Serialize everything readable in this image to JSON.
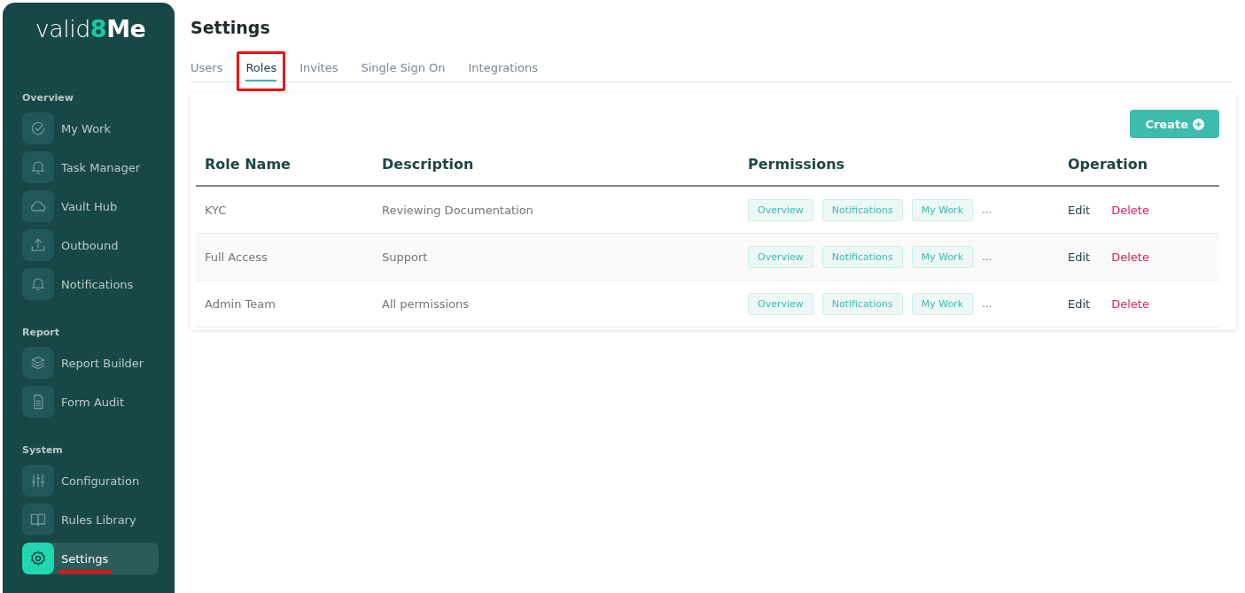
{
  "logo": {
    "parts": [
      "valid",
      "8",
      "Me"
    ]
  },
  "sidebar": {
    "sections": [
      {
        "title": "Overview",
        "items": [
          {
            "label": "My Work",
            "selected": false,
            "highlighted": false
          },
          {
            "label": "Task Manager",
            "selected": false,
            "highlighted": false
          },
          {
            "label": "Vault Hub",
            "selected": false,
            "highlighted": false
          },
          {
            "label": "Outbound",
            "selected": false,
            "highlighted": false
          },
          {
            "label": "Notifications",
            "selected": false,
            "highlighted": false
          }
        ]
      },
      {
        "title": "Report",
        "items": [
          {
            "label": "Report Builder",
            "selected": false,
            "highlighted": false
          },
          {
            "label": "Form Audit",
            "selected": false,
            "highlighted": false
          }
        ]
      },
      {
        "title": "System",
        "items": [
          {
            "label": "Configuration",
            "selected": false,
            "highlighted": false
          },
          {
            "label": "Rules Library",
            "selected": false,
            "highlighted": false
          },
          {
            "label": "Settings",
            "selected": true,
            "highlighted": true
          }
        ]
      }
    ]
  },
  "page": {
    "title": "Settings"
  },
  "tabs": [
    {
      "label": "Users",
      "selected": false,
      "highlighted": false
    },
    {
      "label": "Roles",
      "selected": true,
      "highlighted": true
    },
    {
      "label": "Invites",
      "selected": false,
      "highlighted": false
    },
    {
      "label": "Single Sign On",
      "selected": false,
      "highlighted": false
    },
    {
      "label": "Integrations",
      "selected": false,
      "highlighted": false
    }
  ],
  "create_button": {
    "label": "Create"
  },
  "table": {
    "columns": [
      "Role Name",
      "Description",
      "Permissions",
      "Operation"
    ],
    "rows": [
      {
        "role_name": "KYC",
        "description": "Reviewing Documentation",
        "permissions": [
          "Overview",
          "Notifications",
          "My Work"
        ],
        "more": "...",
        "operations": [
          "Edit",
          "Delete"
        ]
      },
      {
        "role_name": "Full Access",
        "description": "Support",
        "permissions": [
          "Overview",
          "Notifications",
          "My Work"
        ],
        "more": "...",
        "operations": [
          "Edit",
          "Delete"
        ]
      },
      {
        "role_name": "Admin Team",
        "description": "All permissions",
        "permissions": [
          "Overview",
          "Notifications",
          "My Work"
        ],
        "more": "...",
        "operations": [
          "Edit",
          "Delete"
        ]
      }
    ]
  }
}
